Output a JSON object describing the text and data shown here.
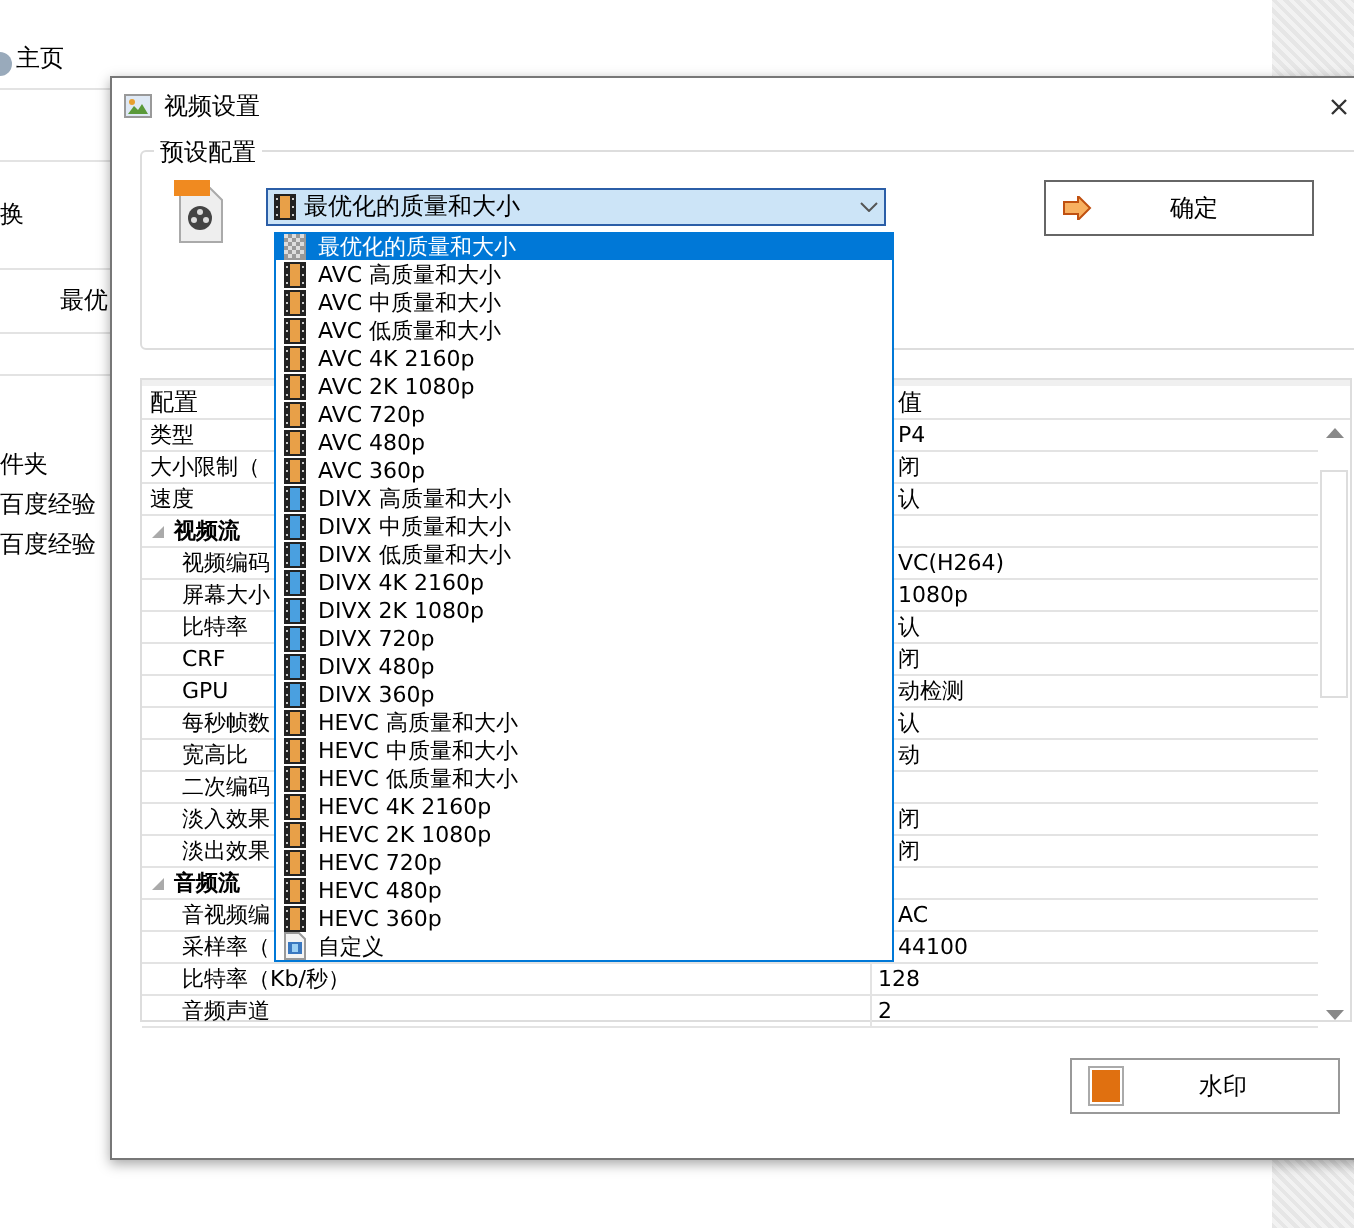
{
  "background_app": {
    "home": "主页",
    "cut_text": "换",
    "button": "最优",
    "side_texts": [
      "件夹",
      "百度经验",
      "百度经验"
    ]
  },
  "window": {
    "title": "视频设置"
  },
  "preset": {
    "group_label": "预设配置",
    "value": "最优化的质量和大小",
    "confirm": "确定",
    "options": [
      {
        "label": "最优化的质量和大小",
        "kind": "auto",
        "selected": true
      },
      {
        "label": "AVC 高质量和大小",
        "kind": "film",
        "color": "#e8a048",
        "selected": false
      },
      {
        "label": "AVC 中质量和大小",
        "kind": "film",
        "color": "#e8a048",
        "selected": false
      },
      {
        "label": "AVC 低质量和大小",
        "kind": "film",
        "color": "#e8a048",
        "selected": false
      },
      {
        "label": "AVC 4K 2160p",
        "kind": "film",
        "color": "#e8a048",
        "selected": false
      },
      {
        "label": "AVC 2K 1080p",
        "kind": "film",
        "color": "#e8a048",
        "selected": false
      },
      {
        "label": "AVC 720p",
        "kind": "film",
        "color": "#e8a048",
        "selected": false
      },
      {
        "label": "AVC 480p",
        "kind": "film",
        "color": "#e8a048",
        "selected": false
      },
      {
        "label": "AVC 360p",
        "kind": "film",
        "color": "#e8a048",
        "selected": false
      },
      {
        "label": "DIVX 高质量和大小",
        "kind": "film",
        "color": "#4aa0e0",
        "selected": false
      },
      {
        "label": "DIVX 中质量和大小",
        "kind": "film",
        "color": "#4aa0e0",
        "selected": false
      },
      {
        "label": "DIVX 低质量和大小",
        "kind": "film",
        "color": "#4aa0e0",
        "selected": false
      },
      {
        "label": "DIVX 4K 2160p",
        "kind": "film",
        "color": "#4aa0e0",
        "selected": false
      },
      {
        "label": "DIVX 2K 1080p",
        "kind": "film",
        "color": "#4aa0e0",
        "selected": false
      },
      {
        "label": "DIVX 720p",
        "kind": "film",
        "color": "#4aa0e0",
        "selected": false
      },
      {
        "label": "DIVX 480p",
        "kind": "film",
        "color": "#4aa0e0",
        "selected": false
      },
      {
        "label": "DIVX 360p",
        "kind": "film",
        "color": "#4aa0e0",
        "selected": false
      },
      {
        "label": "HEVC 高质量和大小",
        "kind": "film",
        "color": "#e8a048",
        "selected": false
      },
      {
        "label": "HEVC 中质量和大小",
        "kind": "film",
        "color": "#e8a048",
        "selected": false
      },
      {
        "label": "HEVC 低质量和大小",
        "kind": "film",
        "color": "#e8a048",
        "selected": false
      },
      {
        "label": "HEVC 4K 2160p",
        "kind": "film",
        "color": "#e8a048",
        "selected": false
      },
      {
        "label": "HEVC 2K 1080p",
        "kind": "film",
        "color": "#e8a048",
        "selected": false
      },
      {
        "label": "HEVC 720p",
        "kind": "film",
        "color": "#e8a048",
        "selected": false
      },
      {
        "label": "HEVC 480p",
        "kind": "film",
        "color": "#e8a048",
        "selected": false
      },
      {
        "label": "HEVC 360p",
        "kind": "film",
        "color": "#e8a048",
        "selected": false
      },
      {
        "label": "自定义",
        "kind": "custom",
        "selected": false
      }
    ]
  },
  "grid": {
    "columns": [
      "配置",
      "值"
    ],
    "rows": [
      {
        "kind": "row",
        "name": "类型",
        "value": "P4"
      },
      {
        "kind": "row",
        "name": "大小限制（",
        "value": "闭"
      },
      {
        "kind": "row",
        "name": "速度",
        "value": "认"
      },
      {
        "kind": "category",
        "name": "视频流",
        "expanded": true,
        "children": [
          {
            "kind": "row",
            "name": "视频编码",
            "value": "VC(H264)"
          },
          {
            "kind": "row",
            "name": "屏幕大小",
            "value": "1080p"
          },
          {
            "kind": "row",
            "name": "比特率",
            "value": "认"
          },
          {
            "kind": "row",
            "name": "CRF",
            "value": "闭"
          },
          {
            "kind": "row",
            "name": "GPU",
            "value": "动检测"
          },
          {
            "kind": "row",
            "name": "每秒帧数",
            "value": "认"
          },
          {
            "kind": "row",
            "name": "宽高比",
            "value": "动"
          },
          {
            "kind": "row",
            "name": "二次编码"
          },
          {
            "kind": "row",
            "name": "淡入效果",
            "value": "闭"
          },
          {
            "kind": "row",
            "name": "淡出效果",
            "value": "闭"
          }
        ]
      },
      {
        "kind": "category",
        "name": "音频流",
        "expanded": true,
        "children": [
          {
            "kind": "row",
            "name": "音视频编",
            "value": "AC"
          },
          {
            "kind": "row",
            "name": "采样率（",
            "value": "44100"
          },
          {
            "kind": "row",
            "name": "比特率（Kb/秒）",
            "value": "128"
          },
          {
            "kind": "row",
            "name": "音频声道",
            "value": "2"
          }
        ]
      }
    ]
  },
  "watermark_button": "水印"
}
